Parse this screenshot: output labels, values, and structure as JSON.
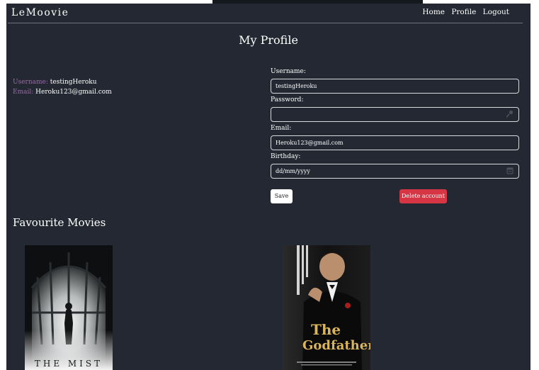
{
  "window_header": "",
  "navbar": {
    "brand": "LeMoovie",
    "links": {
      "home": "Home",
      "profile": "Profile",
      "logout": "Logout"
    }
  },
  "page": {
    "title": "My Profile"
  },
  "user_info": {
    "username_label": "Username:",
    "username_value": "testingHeroku",
    "email_label": "Email:",
    "email_value": "Heroku123@gmail.com"
  },
  "form": {
    "username_label": "Username:",
    "username_value": "testingHeroku",
    "password_label": "Password:",
    "password_value": "",
    "email_label": "Email:",
    "email_value": "Heroku123@gmail.com",
    "birthday_label": "Birthday:",
    "birthday_placeholder": "dd/mm/yyyy",
    "save_label": "Save",
    "delete_label": "Delete account"
  },
  "favourites": {
    "title": "Favourite Movies",
    "movies": [
      {
        "title": "THE MIST"
      },
      {
        "title_line1": "The",
        "title_line2": "Godfather"
      }
    ]
  },
  "colors": {
    "background": "#232832",
    "label_accent": "#9b6aa8",
    "danger": "#d63643"
  }
}
